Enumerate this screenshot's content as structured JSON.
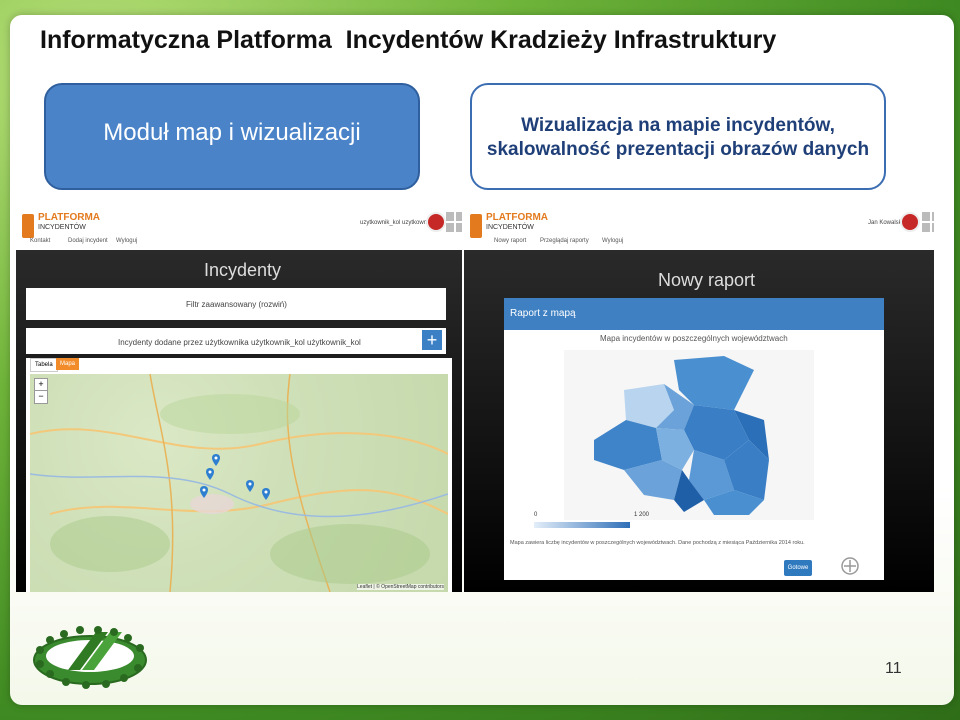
{
  "slide": {
    "title": "Informatyczna Platforma  Incydentów Kradzieży Infrastruktury",
    "box_left": "Moduł map i wizualizacji",
    "box_right_line1": "Wizualizacja na mapie incydentów,",
    "box_right_line2": "skalowalność prezentacji obrazów danych",
    "page_number": "11"
  },
  "left_screenshot": {
    "brand_line1": "PLATFORMA",
    "brand_line2": "INCYDENTÓW",
    "nav": [
      "Kontakt",
      "Dodaj incydent",
      "Wyloguj"
    ],
    "user": "uzytkownik_kol uzytkownik_kol",
    "heading": "Incydenty",
    "filter": "Filtr zaawansowany (rozwiń)",
    "list_title": "Incydenty dodane przez użytkownika użytkownik_kol użytkownik_kol",
    "add_label": "+",
    "tabs": [
      "Tabela",
      "Mapa"
    ],
    "zoom_in": "+",
    "zoom_out": "−",
    "attribution": "Leaflet | © OpenStreetMap contributors"
  },
  "right_screenshot": {
    "brand_line1": "PLATFORMA",
    "brand_line2": "INCYDENTÓW",
    "nav": [
      "Nowy raport",
      "Przeglądaj raporty",
      "Wyloguj"
    ],
    "user": "Jan Kowalski",
    "heading": "Nowy raport",
    "report_bar": "Raport z mapą",
    "chart_title": "Mapa incydentów w poszczególnych województwach",
    "scale_min": "0",
    "scale_max": "1 200",
    "footnote": "Mapa zawiera liczbę incydentów w poszczególnych województwach. Dane pochodzą z miesiąca Października 2014 roku.",
    "done_button": "Gotowe"
  },
  "colors": {
    "accent_blue": "#3f80c2",
    "brand_orange": "#e37a1e",
    "title_box_blue": "#4a83c8"
  }
}
